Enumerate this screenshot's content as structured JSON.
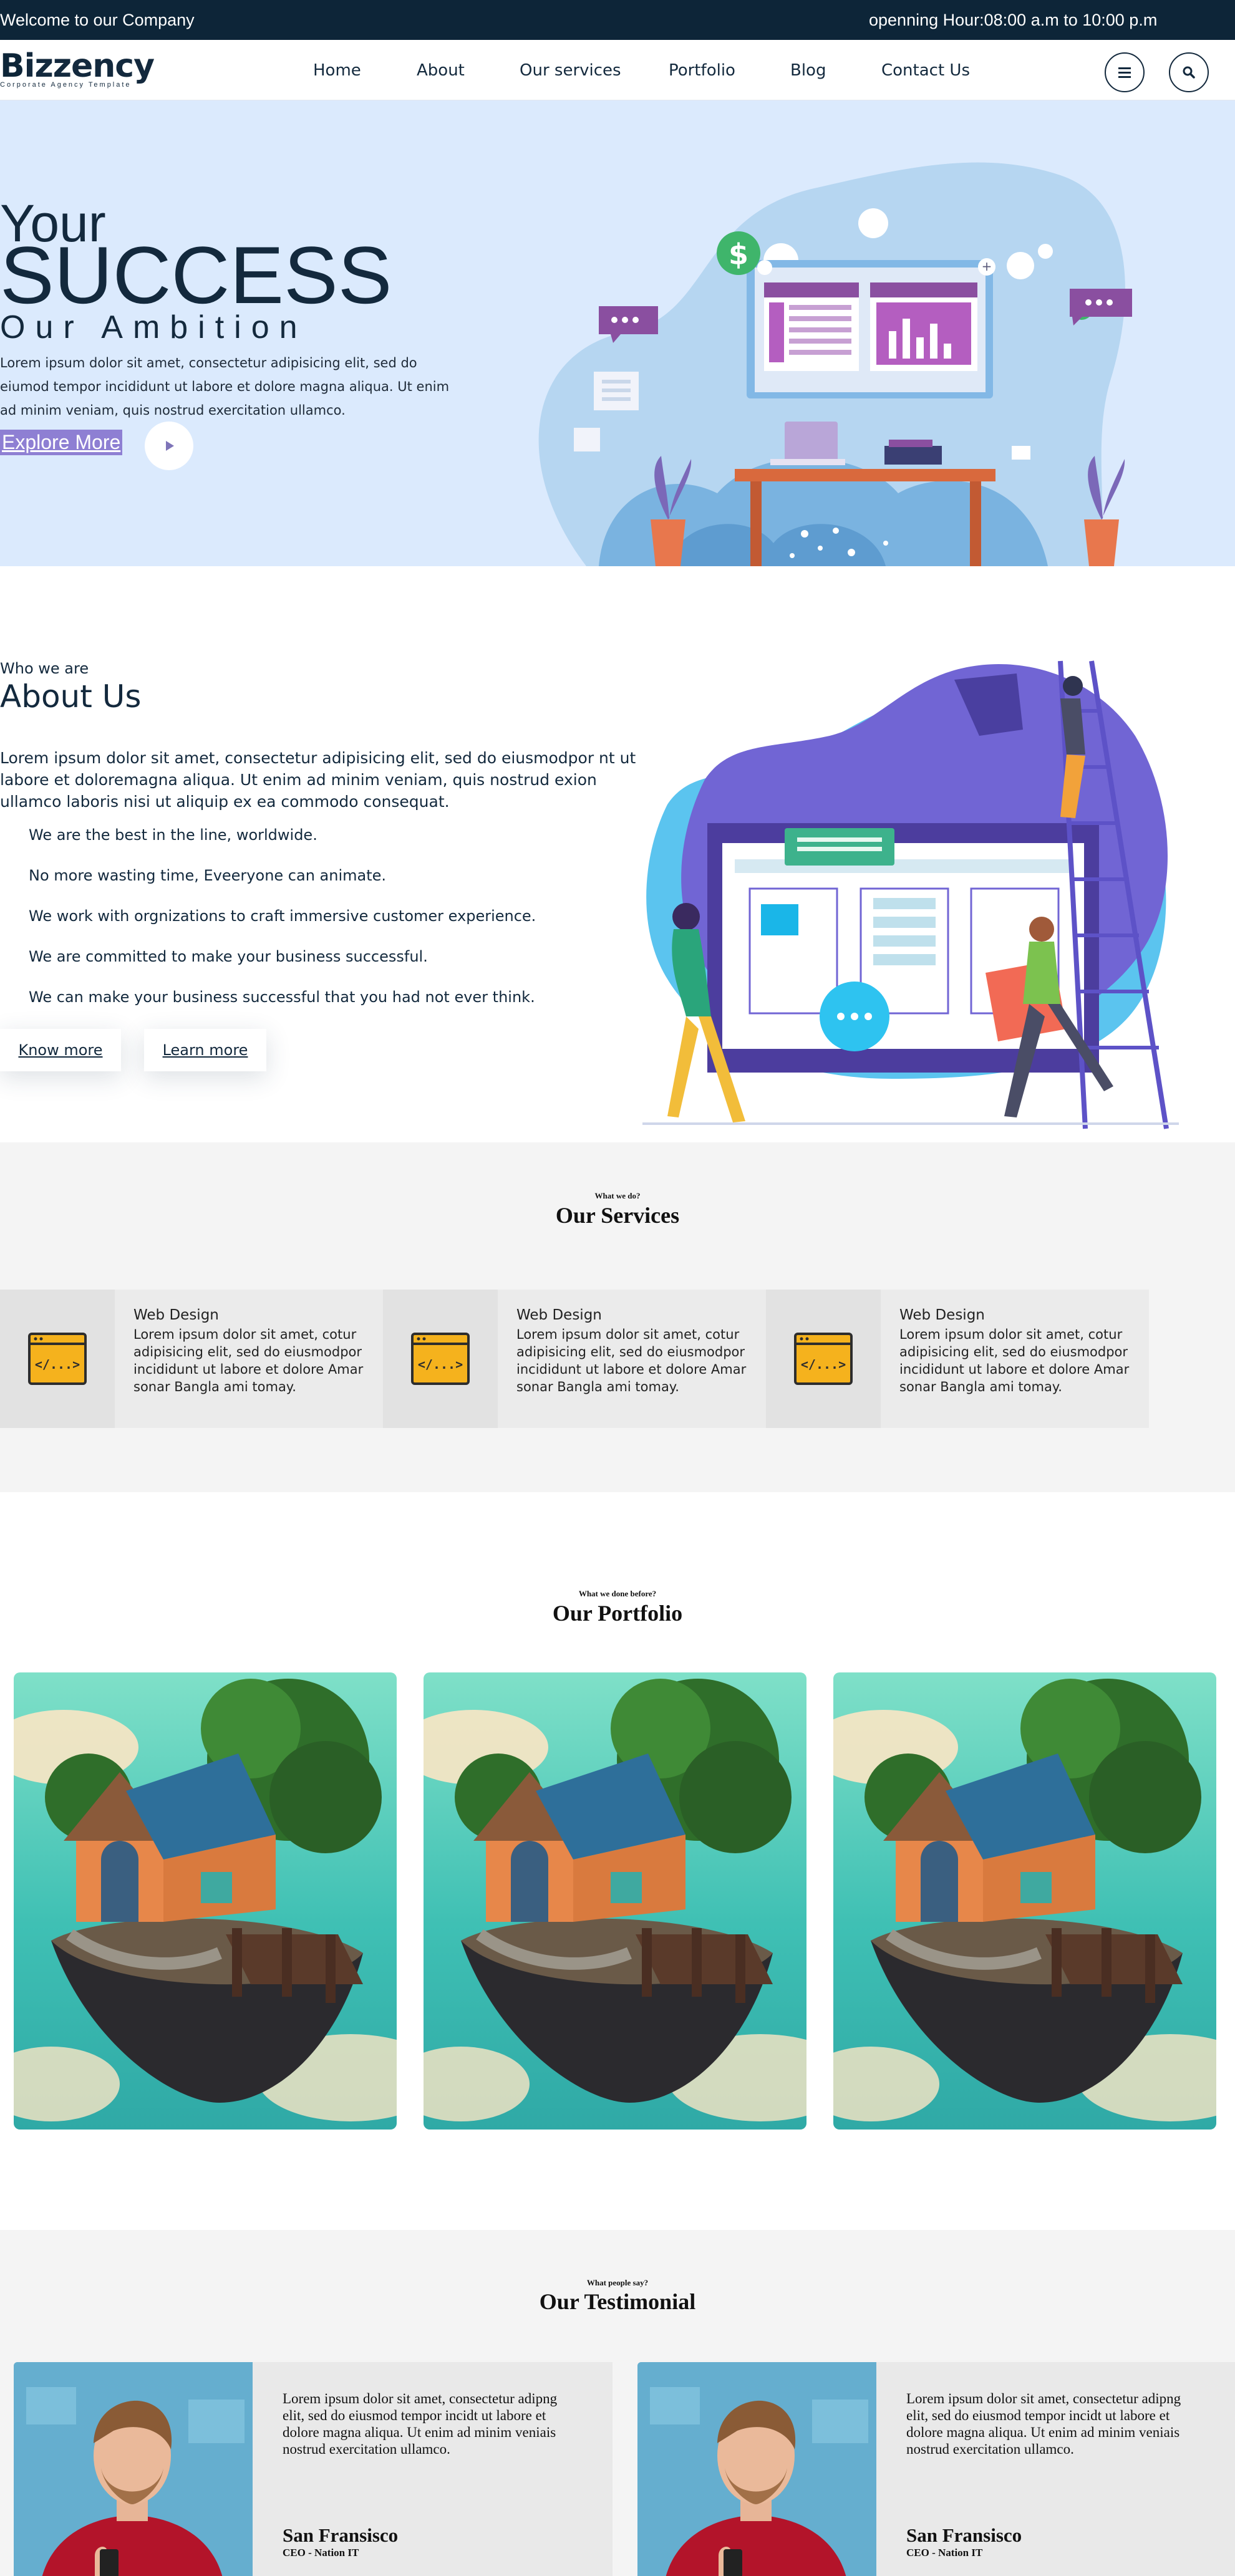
{
  "topbar": {
    "welcome": "Welcome to our Company",
    "hours": "openning Hour:08:00 a.m to 10:00 p.m"
  },
  "nav": {
    "logo_text": "izzency",
    "logo_letter": "B",
    "logo_tagline": "Corporate Agency Template",
    "items": [
      {
        "label": "Home"
      },
      {
        "label": "About"
      },
      {
        "label": "Our services"
      },
      {
        "label": "Portfolio"
      },
      {
        "label": "Blog"
      },
      {
        "label": "Contact Us"
      }
    ],
    "menu_icon": "hamburger-icon",
    "search_icon": "search-icon"
  },
  "hero": {
    "line1": "Your",
    "line2": "SUCCESS",
    "line3": "Our Ambition",
    "text": "Lorem ipsum dolor sit amet, consectetur adipisicing elit, sed do eiumod tempor incididunt ut labore et dolore magna aliqua. Ut enim ad minim veniam, quis nostrud exercitation ullamco.",
    "button": "Explore More",
    "play_icon": "play-icon",
    "dollar_symbol": "$",
    "percent_symbol": "%"
  },
  "about": {
    "subtitle": "Who we are",
    "title": "About Us",
    "paragraph": "Lorem ipsum dolor sit amet, consectetur adipisicing elit, sed do eiusmodpor nt ut labore et doloremagna aliqua. Ut enim ad minim veniam, quis nostrud exion ullamco laboris nisi ut aliquip ex ea commodo consequat.",
    "points": [
      "We are the best in the line, worldwide.",
      "No more wasting time, Eveeryone can animate.",
      "We work with orgnizations to craft immersive customer experience.",
      "We are committed to make your business successful.",
      "We can make your business successful that you had not ever think."
    ],
    "button_know": "Know more",
    "button_learn": "Learn more"
  },
  "services": {
    "subtitle": "What we do?",
    "title": "Our Services",
    "cards": [
      {
        "title": "Web Design",
        "desc": "Lorem ipsum dolor sit amet, cotur adipisicing elit, sed do eiusmodpor incididunt ut labore et dolore Amar sonar Bangla ami tomay.",
        "icon": "code-window-icon",
        "glyph": "</...>"
      },
      {
        "title": "Web Design",
        "desc": "Lorem ipsum dolor sit amet, cotur adipisicing elit, sed do eiusmodpor incididunt ut labore et dolore Amar sonar Bangla ami tomay.",
        "icon": "code-window-icon",
        "glyph": "</...>"
      },
      {
        "title": "Web Design",
        "desc": "Lorem ipsum dolor sit amet, cotur adipisicing elit, sed do eiusmodpor incididunt ut labore et dolore Amar sonar Bangla ami tomay.",
        "icon": "code-window-icon",
        "glyph": "</...>"
      }
    ]
  },
  "portfolio": {
    "subtitle": "What we done before?",
    "title": "Our Portfolio",
    "items": [
      "floating-island-house-image",
      "floating-island-house-image",
      "floating-island-house-image"
    ]
  },
  "testimonial": {
    "subtitle": "What people say?",
    "title": "Our Testimonial",
    "items": [
      {
        "quote": "Lorem ipsum dolor sit amet, consectetur adipng elit, sed do eiusmod tempor incidt ut labore et dolore magna aliqua. Ut enim ad minim veniais nostrud exercitation ullamco.",
        "name": "San Fransisco",
        "role": "CEO - Nation IT"
      },
      {
        "quote": "Lorem ipsum dolor sit amet, consectetur adipng elit, sed do eiusmod tempor incidt ut labore et dolore magna aliqua. Ut enim ad minim veniais nostrud exercitation ullamco.",
        "name": "San Fransisco",
        "role": "CEO - Nation IT"
      }
    ]
  },
  "colors": {
    "navy": "#0d2538",
    "hero_bg": "#dbeafd",
    "purple": "#8e7fd3",
    "accent_yellow": "#f2b720",
    "section_gray": "#f4f4f4"
  }
}
